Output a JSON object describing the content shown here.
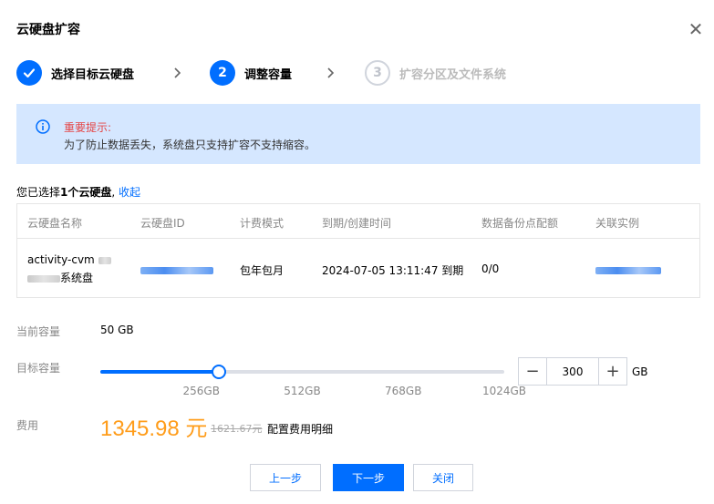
{
  "dialog": {
    "title": "云硬盘扩容",
    "close_icon": "close-icon"
  },
  "steps": [
    {
      "number": "1",
      "label": "选择目标云硬盘",
      "state": "done"
    },
    {
      "number": "2",
      "label": "调整容量",
      "state": "active"
    },
    {
      "number": "3",
      "label": "扩容分区及文件系统",
      "state": "pending"
    }
  ],
  "notice": {
    "title": "重要提示:",
    "text": "为了防止数据丢失，系统盘只支持扩容不支持缩容。"
  },
  "selection": {
    "prefix": "您已选择",
    "count": "1个云硬盘",
    "suffix": ",",
    "collapse": "收起"
  },
  "table": {
    "columns": [
      "云硬盘名称",
      "云硬盘ID",
      "计费模式",
      "到期/创建时间",
      "数据备份点配额",
      "关联实例"
    ],
    "rows": [
      {
        "name_line1": "activity-cvm",
        "name_line2": "系统盘",
        "billing": "包年包月",
        "expire": "2024-07-05 13:11:47 到期",
        "backup_quota": "0/0"
      }
    ]
  },
  "capacity": {
    "current_label": "当前容量",
    "current_value": "50 GB",
    "target_label": "目标容量",
    "target_value": "300",
    "unit": "GB",
    "slider_min": 0,
    "slider_max": 1024,
    "slider_value": 300,
    "ticks": [
      "256GB",
      "512GB",
      "768GB",
      "1024GB"
    ],
    "tick_values": [
      256,
      512,
      768,
      1024
    ]
  },
  "fee": {
    "label": "费用",
    "price": "1345.98 元",
    "original": "1621.67元",
    "detail": "配置费用明细"
  },
  "footer": {
    "prev": "上一步",
    "next": "下一步",
    "close": "关闭"
  },
  "colors": {
    "primary": "#006eff",
    "warning_text": "#e54545",
    "price": "#ff9c19",
    "notice_bg": "#d5e7ff"
  }
}
